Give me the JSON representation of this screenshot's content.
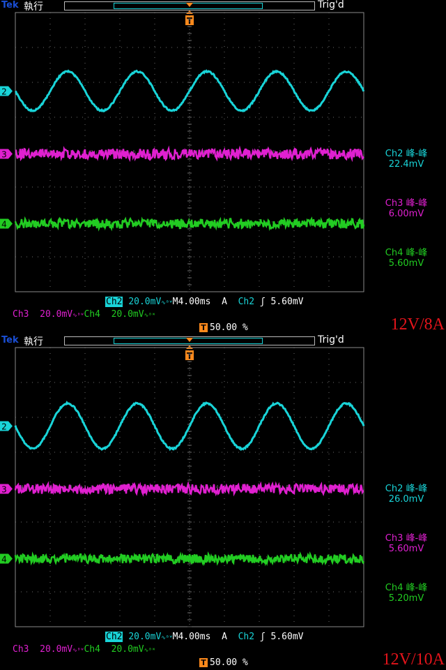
{
  "colors": {
    "ch2": "#19d4d8",
    "ch3": "#e020d0",
    "ch4": "#22cc22",
    "trigger": "#ff8a1c",
    "grid": "#6e6e6e",
    "label": "#e4141b"
  },
  "screens": [
    {
      "brand": "Tek",
      "run_state": "執行",
      "trig_status": "Trig'd",
      "trigger_marker": "T",
      "channel_markers": {
        "ch2": "2",
        "ch3": "3",
        "ch4": "4"
      },
      "measurements": [
        {
          "channel": "Ch2",
          "type": "峰-峰",
          "value": "22.4mV"
        },
        {
          "channel": "Ch3",
          "type": "峰-峰",
          "value": "6.00mV"
        },
        {
          "channel": "Ch4",
          "type": "峰-峰",
          "value": "5.60mV"
        }
      ],
      "status": {
        "ch2": "Ch2",
        "ch2_scale": "20.0mV",
        "bw": "ᴮᵂ",
        "timebase": "M4.00ms",
        "trig_mode": "A",
        "trig_src": "Ch2",
        "trig_slope": "ʃ",
        "trig_level": "5.60mV",
        "ch3": "Ch3",
        "ch3_scale": "20.0mV",
        "ch4": "Ch4",
        "ch4_scale": "20.0mV",
        "trig_pos": "50.00 %"
      },
      "load_label": "12V/8A",
      "waveform": {
        "ch2_amplitude_pp_mV": 22.4,
        "ch2_period_ms": 8.0,
        "ch3_pp_mV": 6.0,
        "ch4_pp_mV": 5.6
      }
    },
    {
      "brand": "Tek",
      "run_state": "執行",
      "trig_status": "Trig'd",
      "trigger_marker": "T",
      "channel_markers": {
        "ch2": "2",
        "ch3": "3",
        "ch4": "4"
      },
      "measurements": [
        {
          "channel": "Ch2",
          "type": "峰-峰",
          "value": "26.0mV"
        },
        {
          "channel": "Ch3",
          "type": "峰-峰",
          "value": "5.60mV"
        },
        {
          "channel": "Ch4",
          "type": "峰-峰",
          "value": "5.20mV"
        }
      ],
      "status": {
        "ch2": "Ch2",
        "ch2_scale": "20.0mV",
        "bw": "ᴮᵂ",
        "timebase": "M4.00ms",
        "trig_mode": "A",
        "trig_src": "Ch2",
        "trig_slope": "ʃ",
        "trig_level": "5.60mV",
        "ch3": "Ch3",
        "ch3_scale": "20.0mV",
        "ch4": "Ch4",
        "ch4_scale": "20.0mV",
        "trig_pos": "50.00 %"
      },
      "load_label": "12V/10A",
      "waveform": {
        "ch2_amplitude_pp_mV": 26.0,
        "ch2_period_ms": 8.0,
        "ch3_pp_mV": 5.6,
        "ch4_pp_mV": 5.2
      }
    }
  ]
}
